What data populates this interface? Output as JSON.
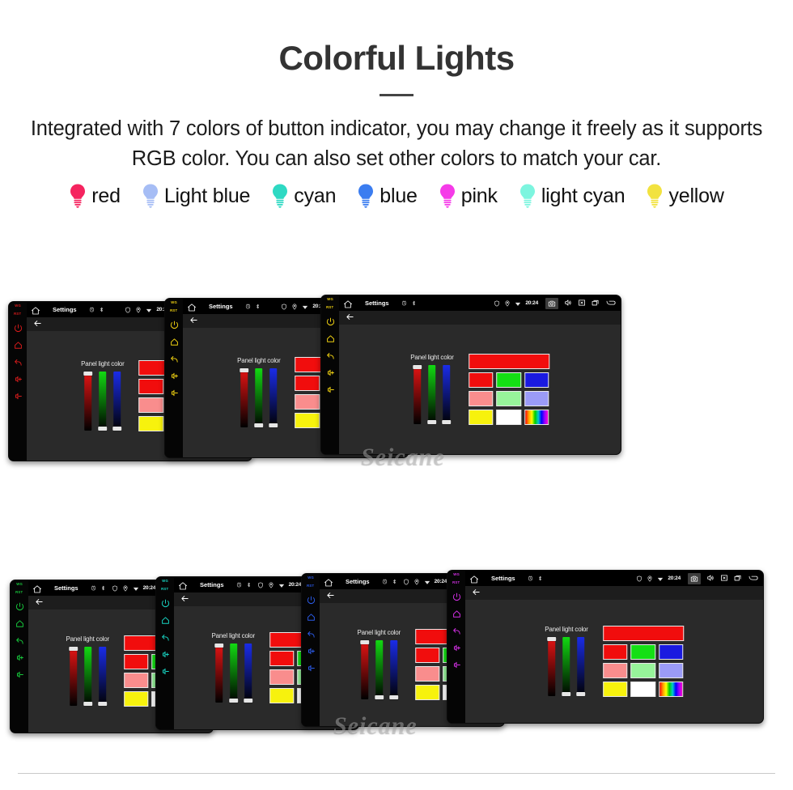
{
  "header": {
    "title": "Colorful Lights",
    "subtitle": "Integrated with 7 colors of button indicator, you may change it freely as it supports RGB color. You can also set other colors to match your car."
  },
  "legend": {
    "items": [
      {
        "label": "red",
        "color": "#F5245F",
        "icon": "bulb-icon"
      },
      {
        "label": "Light blue",
        "color": "#A6BDF5",
        "icon": "bulb-icon"
      },
      {
        "label": "cyan",
        "color": "#2ED9C3",
        "icon": "bulb-icon"
      },
      {
        "label": "blue",
        "color": "#3B7DF0",
        "icon": "bulb-icon"
      },
      {
        "label": "pink",
        "color": "#F53BE8",
        "icon": "bulb-icon"
      },
      {
        "label": "light cyan",
        "color": "#7DF5DF",
        "icon": "bulb-icon"
      },
      {
        "label": "yellow",
        "color": "#F2E23F",
        "icon": "bulb-icon"
      }
    ]
  },
  "device_ui": {
    "status_bar": {
      "home_icon": "home-icon",
      "title": "Settings",
      "mini_icons": [
        "power-icon",
        "bluetooth-icon"
      ],
      "tray_icons": [
        "shield-icon",
        "location-pin-icon",
        "wifi-icon"
      ],
      "time": "20:24",
      "nav_icons": [
        "camera-icon",
        "volume-icon",
        "close-box-icon",
        "recents-icon",
        "back-icon"
      ]
    },
    "action_bar": {
      "back_icon": "back-arrow-icon"
    },
    "panel": {
      "label": "Panel light color",
      "sliders": [
        {
          "name": "red-slider",
          "color": "#E81414",
          "value": 100
        },
        {
          "name": "green-slider",
          "color": "#12D912",
          "value": 0
        },
        {
          "name": "blue-slider",
          "color": "#1A2CE8",
          "value": 0
        }
      ],
      "preview_color": "#F10D0D",
      "swatch_rows": [
        [
          "#F10D0D",
          "#14E014",
          "#1A1AE0"
        ],
        [
          "#F98D8D",
          "#97F49A",
          "#9B9BF7"
        ],
        [
          "#F7F20D",
          "#FFFFFF",
          "rainbow"
        ]
      ]
    }
  },
  "rows": [
    {
      "name": "row-1",
      "devices": [
        {
          "name": "device-red",
          "button_color": "#D81B1B",
          "micro_labels": [
            "WG",
            "RST"
          ]
        },
        {
          "name": "device-yellow",
          "button_color": "#F2D312",
          "micro_labels": [
            "WG",
            "RST"
          ]
        },
        {
          "name": "device-yellow-front",
          "button_color": "#F2D312",
          "micro_labels": [
            "WG",
            "RST"
          ]
        }
      ]
    },
    {
      "name": "row-2",
      "devices": [
        {
          "name": "device-green",
          "button_color": "#17C93C",
          "micro_labels": [
            "WG",
            "RST"
          ]
        },
        {
          "name": "device-cyan",
          "button_color": "#18D6C4",
          "micro_labels": [
            "WG",
            "RST"
          ]
        },
        {
          "name": "device-blue",
          "button_color": "#2B5BE8",
          "micro_labels": [
            "WG",
            "RST"
          ]
        },
        {
          "name": "device-magenta",
          "button_color": "#D630E8",
          "micro_labels": [
            "WG",
            "RST"
          ]
        }
      ]
    }
  ],
  "watermark": {
    "text": "Seicane"
  }
}
